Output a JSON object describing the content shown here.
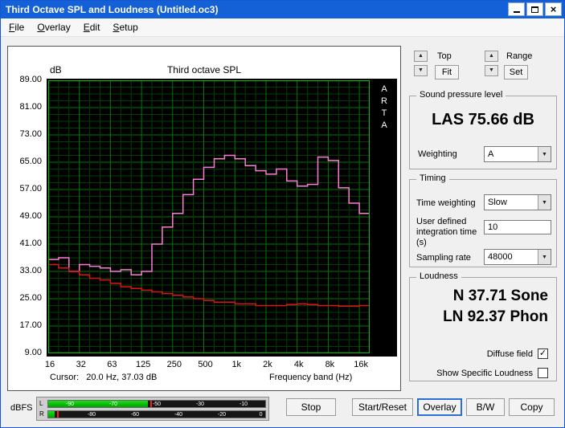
{
  "window": {
    "title": "Third Octave SPL and Loudness (Untitled.oc3)"
  },
  "menu": {
    "items": [
      "File",
      "Overlay",
      "Edit",
      "Setup"
    ]
  },
  "icons": {
    "up_arrow": "▲",
    "down_arrow": "▼",
    "dropdown_arrow": "▼",
    "check": "✓",
    "close": "×"
  },
  "chart_data": {
    "type": "bar",
    "title": "Third octave SPL",
    "ylabel": "dB",
    "xlabel": "Frequency band (Hz)",
    "ylim": [
      9,
      89
    ],
    "ytick_step": 8,
    "grid_minor_step": 2,
    "grid_minor_color": "#003f00",
    "grid_major_color": "#007a00",
    "border_color": "#00c800",
    "plot_bg": "#000000",
    "watermark": "ARTA",
    "yticks": [
      "89.00",
      "81.00",
      "73.00",
      "65.00",
      "57.00",
      "49.00",
      "41.00",
      "33.00",
      "25.00",
      "17.00",
      "9.00"
    ],
    "xticks": [
      "16",
      "32",
      "63",
      "125",
      "250",
      "500",
      "1k",
      "2k",
      "4k",
      "8k",
      "16k"
    ],
    "bands": [
      "16",
      "20",
      "25",
      "31.5",
      "40",
      "50",
      "63",
      "80",
      "100",
      "125",
      "160",
      "200",
      "250",
      "315",
      "400",
      "500",
      "630",
      "800",
      "1k",
      "1.25k",
      "1.6k",
      "2k",
      "2.5k",
      "3.15k",
      "4k",
      "5k",
      "6.3k",
      "8k",
      "10k",
      "12.5k",
      "16k"
    ],
    "series": [
      {
        "name": "Third octave SPL",
        "color": "#ff7ad9",
        "values": [
          36.5,
          37,
          33,
          35,
          34.5,
          34,
          33,
          33.5,
          32,
          33,
          41,
          46,
          50,
          55.5,
          60,
          63.5,
          66,
          67,
          66,
          64,
          62.5,
          61.5,
          63,
          59.5,
          58,
          58.5,
          66.5,
          65.5,
          57.5,
          53,
          50
        ]
      },
      {
        "name": "Overlay curve",
        "color": "#dd1414",
        "values": [
          35,
          34,
          33,
          32,
          31,
          30.5,
          29.5,
          28.5,
          28,
          27.5,
          27,
          26.5,
          26,
          25.5,
          25,
          24.5,
          24,
          24,
          23.5,
          23.5,
          23,
          23,
          23,
          23.3,
          23.5,
          23.3,
          23,
          23,
          22.8,
          22.8,
          23
        ]
      }
    ],
    "cursor_text": "Cursor:   20.0 Hz, 37.03 dB"
  },
  "nav": {
    "top_label": "Top",
    "fit_label": "Fit",
    "range_label": "Range",
    "set_label": "Set"
  },
  "spl_group": {
    "legend": "Sound pressure level",
    "reading": "LAS 75.66 dB",
    "weighting_label": "Weighting",
    "weighting_value": "A"
  },
  "timing_group": {
    "legend": "Timing",
    "time_weighting_label": "Time weighting",
    "time_weighting_value": "Slow",
    "integration_label": "User defined integration time (s)",
    "integration_value": "10",
    "sampling_label": "Sampling rate",
    "sampling_value": "48000"
  },
  "loudness_group": {
    "legend": "Loudness",
    "n_reading": "N 37.71 Sone",
    "ln_reading": "LN 92.37 Phon",
    "diffuse_label": "Diffuse field",
    "diffuse_checked": true,
    "specific_label": "Show Specific Loudness",
    "specific_checked": false
  },
  "buttons": {
    "stop": "Stop",
    "start_reset": "Start/Reset",
    "overlay": "Overlay",
    "bw": "B/W",
    "copy": "Copy"
  },
  "meter": {
    "label": "dBFS",
    "channels": [
      {
        "name": "L",
        "fill_pct": 46,
        "peak_pct": 47,
        "labels": [
          {
            "t": "-90",
            "p": 10
          },
          {
            "t": "-70",
            "p": 30
          },
          {
            "t": "-50",
            "p": 50
          },
          {
            "t": "-30",
            "p": 70
          },
          {
            "t": "-10",
            "p": 90
          }
        ]
      },
      {
        "name": "R",
        "fill_pct": 3,
        "peak_pct": 4,
        "labels": [
          {
            "t": "-80",
            "p": 20
          },
          {
            "t": "-60",
            "p": 40
          },
          {
            "t": "-40",
            "p": 60
          },
          {
            "t": "-20",
            "p": 80
          },
          {
            "t": "0",
            "p": 98
          }
        ]
      }
    ]
  }
}
